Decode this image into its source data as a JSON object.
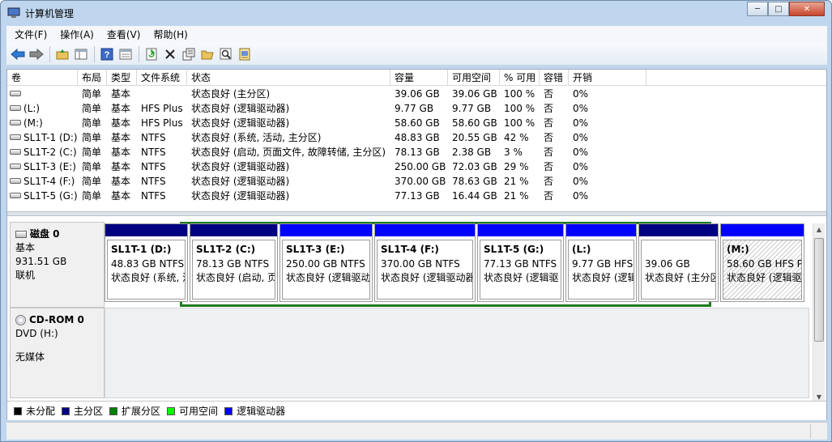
{
  "window": {
    "title": "计算机管理",
    "minimize": "─",
    "maximize": "□",
    "close": "✕"
  },
  "menu": [
    "文件(F)",
    "操作(A)",
    "查看(V)",
    "帮助(H)"
  ],
  "toolbar": [
    "back-icon",
    "forward-icon",
    "up-folder-icon",
    "show-hide-tree-icon",
    "help-icon",
    "properties-pane-icon",
    "refresh-icon",
    "delete-icon",
    "properties-icon",
    "open-icon",
    "search-icon",
    "export-icon"
  ],
  "columns": [
    "卷",
    "布局",
    "类型",
    "文件系统",
    "状态",
    "容量",
    "可用空间",
    "% 可用",
    "容错",
    "开销"
  ],
  "volumes": [
    [
      "",
      "简单",
      "基本",
      "",
      "状态良好 (主分区)",
      "39.06 GB",
      "39.06 GB",
      "100 %",
      "否",
      "0%"
    ],
    [
      "(L:)",
      "简单",
      "基本",
      "HFS Plus",
      "状态良好 (逻辑驱动器)",
      "9.77 GB",
      "9.77 GB",
      "100 %",
      "否",
      "0%"
    ],
    [
      "(M:)",
      "简单",
      "基本",
      "HFS Plus",
      "状态良好 (逻辑驱动器)",
      "58.60 GB",
      "58.60 GB",
      "100 %",
      "否",
      "0%"
    ],
    [
      "SL1T-1 (D:)",
      "简单",
      "基本",
      "NTFS",
      "状态良好 (系统, 活动, 主分区)",
      "48.83 GB",
      "20.55 GB",
      "42 %",
      "否",
      "0%"
    ],
    [
      "SL1T-2 (C:)",
      "简单",
      "基本",
      "NTFS",
      "状态良好 (启动, 页面文件, 故障转储, 主分区)",
      "78.13 GB",
      "2.38 GB",
      "3 %",
      "否",
      "0%"
    ],
    [
      "SL1T-3 (E:)",
      "简单",
      "基本",
      "NTFS",
      "状态良好 (逻辑驱动器)",
      "250.00 GB",
      "72.03 GB",
      "29 %",
      "否",
      "0%"
    ],
    [
      "SL1T-4 (F:)",
      "简单",
      "基本",
      "NTFS",
      "状态良好 (逻辑驱动器)",
      "370.00 GB",
      "78.63 GB",
      "21 %",
      "否",
      "0%"
    ],
    [
      "SL1T-5 (G:)",
      "简单",
      "基本",
      "NTFS",
      "状态良好 (逻辑驱动器)",
      "77.13 GB",
      "16.44 GB",
      "21 %",
      "否",
      "0%"
    ]
  ],
  "disk0": {
    "name": "磁盘 0",
    "type": "基本",
    "size": "931.51 GB",
    "status": "联机"
  },
  "partitions": [
    {
      "name": "SL1T-1  (D:)",
      "size": "48.83 GB NTFS",
      "status": "状态良好 (系统, 活",
      "kind": "primary"
    },
    {
      "name": "SL1T-2  (C:)",
      "size": "78.13 GB NTFS",
      "status": "状态良好 (启动, 页",
      "kind": "primary"
    },
    {
      "name": "SL1T-3  (E:)",
      "size": "250.00 GB NTFS",
      "status": "状态良好 (逻辑驱动",
      "kind": "logical"
    },
    {
      "name": "SL1T-4  (F:)",
      "size": "370.00 GB NTFS",
      "status": "状态良好 (逻辑驱动器",
      "kind": "logical"
    },
    {
      "name": "SL1T-5  (G:)",
      "size": "77.13 GB NTFS",
      "status": "状态良好 (逻辑驱",
      "kind": "logical"
    },
    {
      "name": "(L:)",
      "size": "9.77 GB HFS",
      "status": "状态良好 (逻辑",
      "kind": "logical"
    },
    {
      "name": "",
      "size": "39.06 GB",
      "status": "状态良好 (主分区",
      "kind": "primary"
    },
    {
      "name": "(M:)",
      "size": "58.60 GB HFS P",
      "status": "状态良好 (逻辑驱",
      "kind": "logical-selected"
    }
  ],
  "cdrom": {
    "name": "CD-ROM 0",
    "drive": "DVD (H:)",
    "status": "无媒体"
  },
  "legend": [
    {
      "label": "未分配",
      "color": "#000000"
    },
    {
      "label": "主分区",
      "color": "#000080"
    },
    {
      "label": "扩展分区",
      "color": "#008000"
    },
    {
      "label": "可用空间",
      "color": "#00ff00"
    },
    {
      "label": "逻辑驱动器",
      "color": "#0000ff"
    }
  ],
  "colors": {
    "primary_bar": "#000080",
    "logical_bar": "#0000ff",
    "extended_frame": "#1e7a1e"
  }
}
